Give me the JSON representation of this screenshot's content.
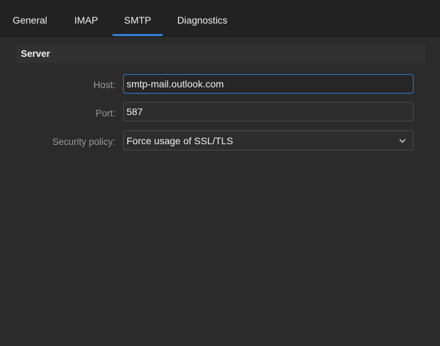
{
  "tabs": {
    "general": "General",
    "imap": "IMAP",
    "smtp": "SMTP",
    "diagnostics": "Diagnostics",
    "active": "SMTP"
  },
  "server": {
    "title": "Server",
    "host": {
      "label": "Host:",
      "value": "smtp-mail.outlook.com"
    },
    "port": {
      "label": "Port:",
      "value": "587"
    },
    "security_policy": {
      "label": "Security policy:",
      "selected": "Force usage of SSL/TLS",
      "icon": "chevron-down-icon"
    }
  },
  "colors": {
    "accent": "#2f80d8",
    "background": "#2b2b2b",
    "tabbar": "#222222"
  }
}
